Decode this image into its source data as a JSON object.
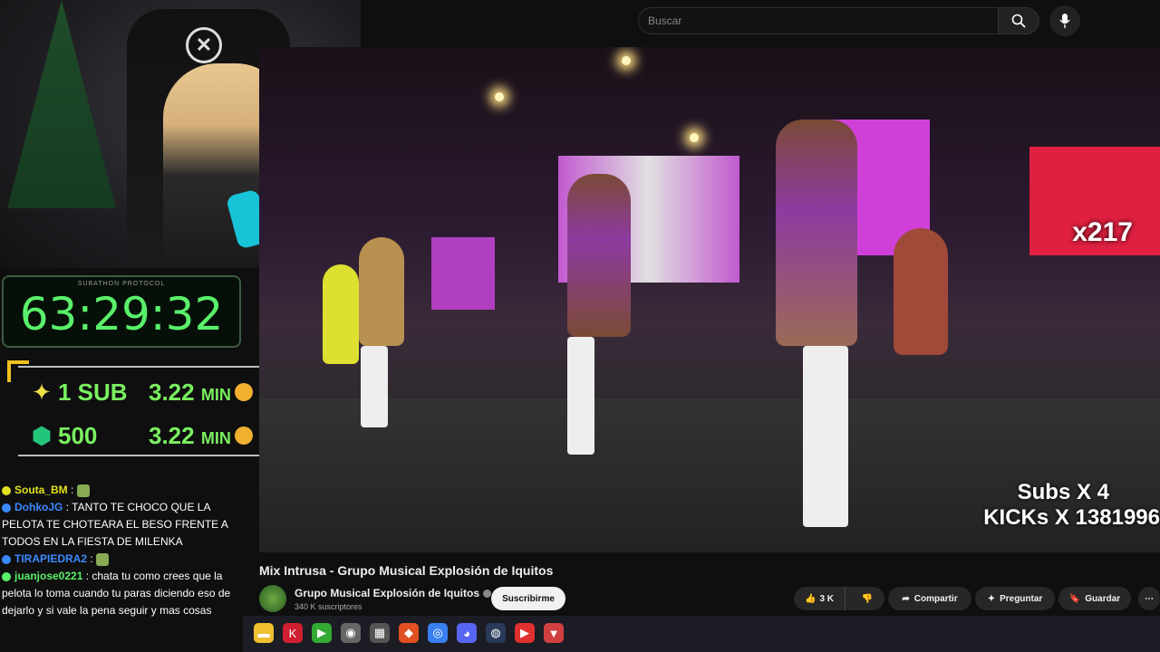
{
  "search": {
    "placeholder": "Buscar"
  },
  "timer": {
    "tag": "SUBATHON PROTOCOL",
    "value": "63:29:32"
  },
  "goals": [
    {
      "left": "1 SUB",
      "right": "3.22",
      "unit": "MIN"
    },
    {
      "left": "500",
      "right": "3.22",
      "unit": "MIN"
    }
  ],
  "chat": [
    {
      "user": "Souta_BM",
      "user_color": "#e0e020",
      "text": " : ",
      "emote": true
    },
    {
      "user": "DohkoJG",
      "user_color": "#3a8aff",
      "text": " : TANTO TE CHOCO QUE LA PELOTA TE CHOTEARA EL BESO FRENTE A TODOS EN LA FIESTA DE MILENKA",
      "emote": false
    },
    {
      "user": "TIRAPIEDRA2",
      "user_color": "#3a8aff",
      "text": " : ",
      "emote": true
    },
    {
      "user": "juanjose0221",
      "user_color": "#5af06a",
      "text": " : chata tu como crees que la pelota lo toma cuando tu paras diciendo eso de dejarlo y si vale la pena seguir y mas cosas",
      "emote": false
    }
  ],
  "video": {
    "title": "Mix Intrusa - Grupo Musical Explosión de Iquitos",
    "overlay_multiplier": "x217",
    "overlay_subs": "Subs X",
    "overlay_subs_num": "4",
    "overlay_kicks": "KICKs X 1381996"
  },
  "channel": {
    "name": "Grupo Musical Explosión de Iquitos",
    "subs": "340 K suscriptores",
    "subscribe_label": "Suscribirme"
  },
  "actions": {
    "likes": "3 K",
    "share": "Compartir",
    "ask": "Preguntar",
    "save": "Guardar"
  },
  "colors": {
    "timer_green": "#5af06a",
    "goal_green": "#7af060",
    "bracket_gold": "#f0c020"
  },
  "taskbar_icons": [
    "folder-icon",
    "kick-icon",
    "app-icon",
    "obs-icon",
    "app-icon",
    "brave-icon",
    "chrome-icon",
    "discord-icon",
    "steam-icon",
    "media-icon",
    "valorant-icon"
  ]
}
